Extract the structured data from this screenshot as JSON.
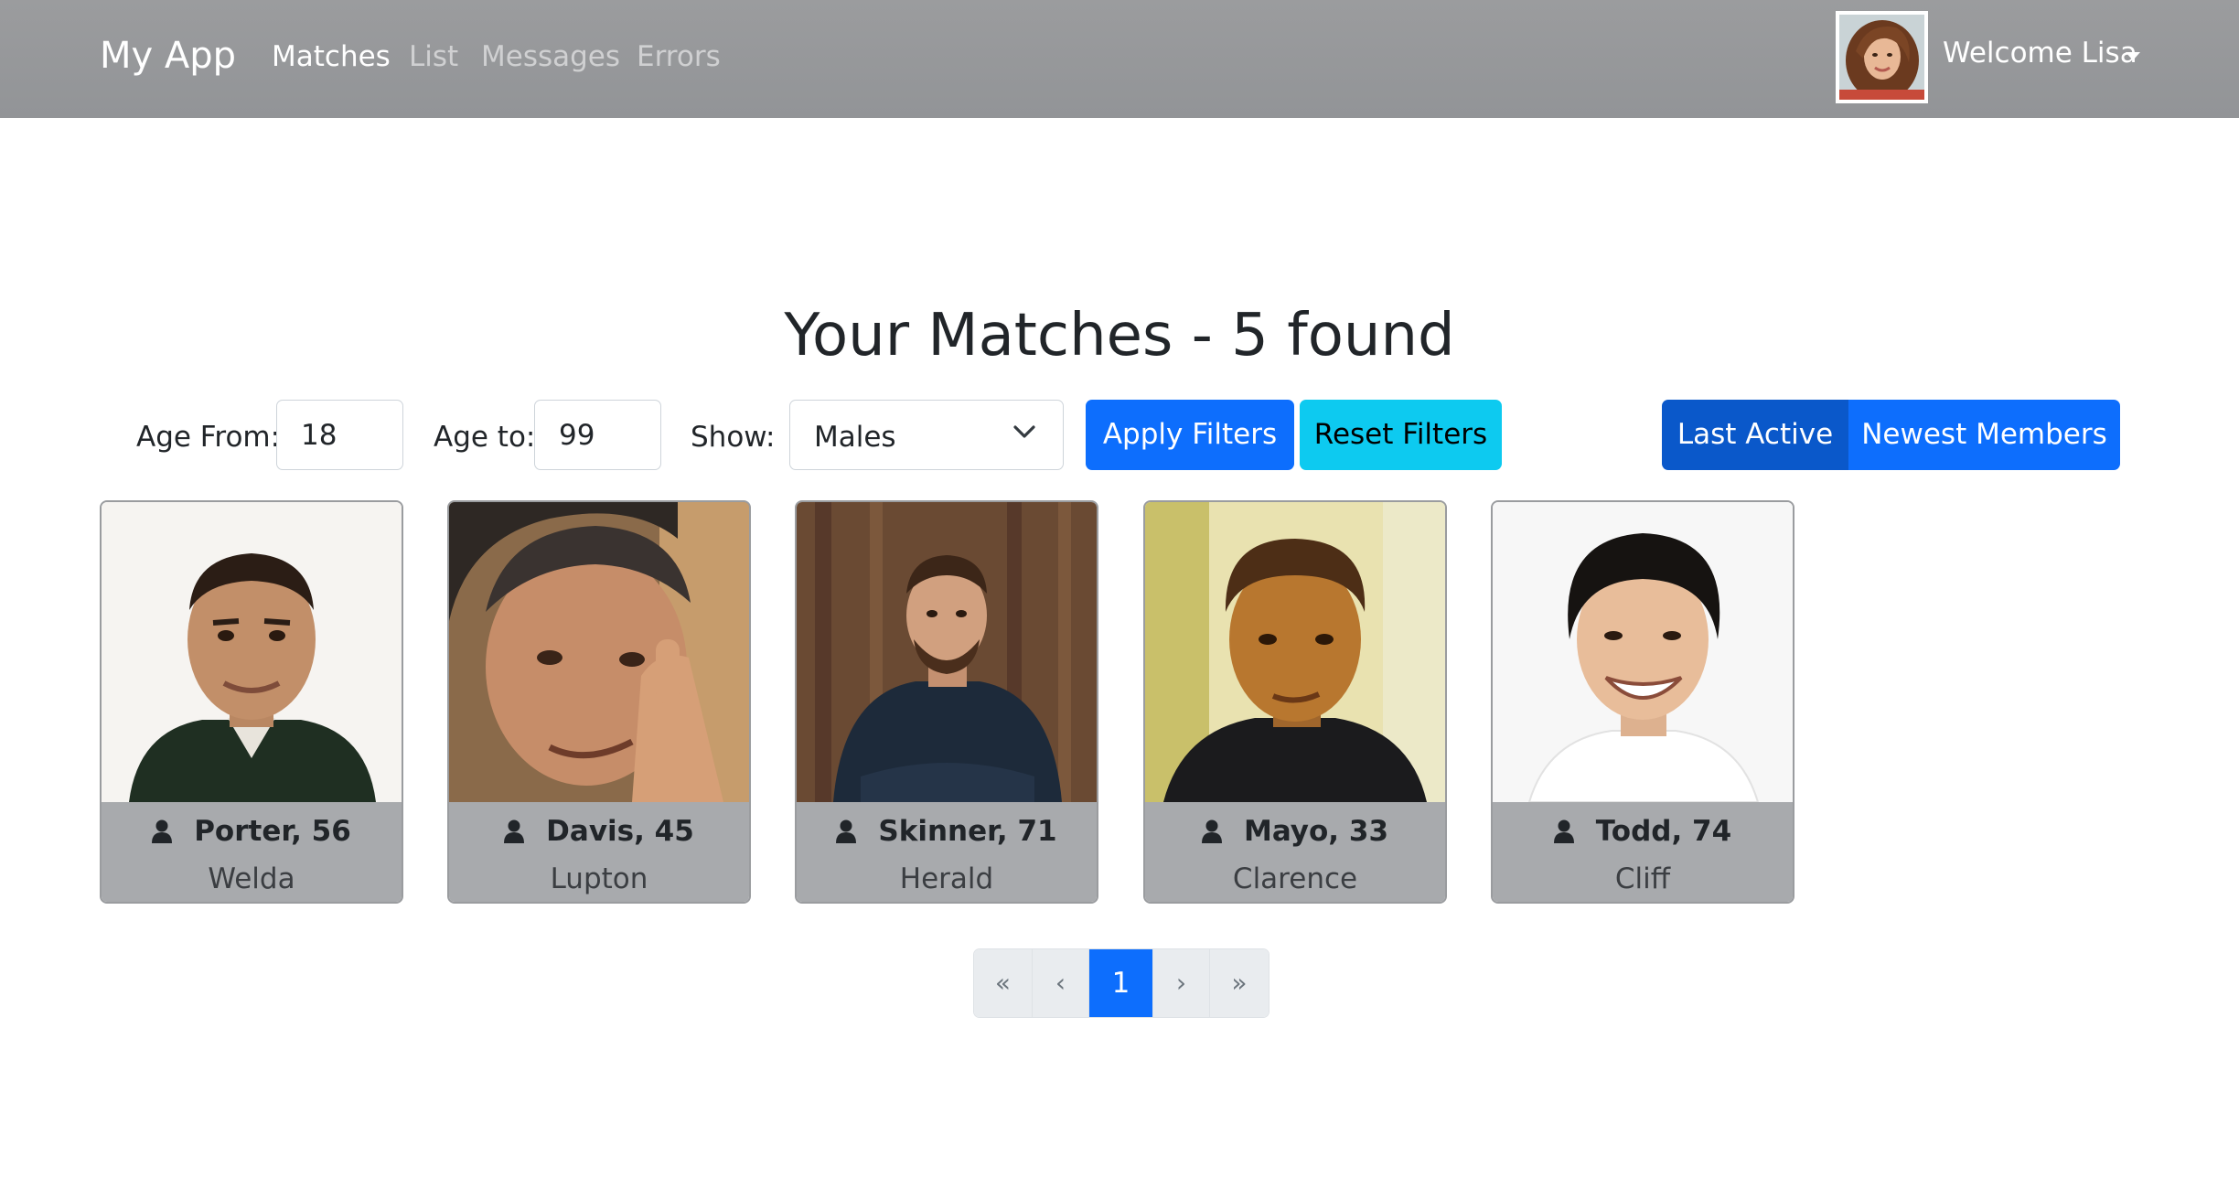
{
  "navbar": {
    "brand": "My App",
    "links": [
      {
        "label": "Matches",
        "active": true
      },
      {
        "label": "List",
        "active": false
      },
      {
        "label": "Messages",
        "active": false
      },
      {
        "label": "Errors",
        "active": false
      }
    ],
    "welcome": "Welcome Lisa",
    "avatar_icon": "user-avatar-photo"
  },
  "main": {
    "title": "Your Matches - 5 found"
  },
  "filters": {
    "age_from_label": "Age From:",
    "age_from_value": "18",
    "age_to_label": "Age to:",
    "age_to_value": "99",
    "show_label": "Show:",
    "show_value": "Males",
    "apply_label": "Apply Filters",
    "reset_label": "Reset Filters",
    "sort": {
      "last_active_label": "Last Active",
      "newest_label": "Newest Members",
      "selected": "Last Active"
    }
  },
  "members": [
    {
      "name_age": "Porter, 56",
      "city": "Welda"
    },
    {
      "name_age": "Davis, 45",
      "city": "Lupton"
    },
    {
      "name_age": "Skinner, 71",
      "city": "Herald"
    },
    {
      "name_age": "Mayo, 33",
      "city": "Clarence"
    },
    {
      "name_age": "Todd, 74",
      "city": "Cliff"
    }
  ],
  "pagination": {
    "first": "«",
    "prev": "‹",
    "current": "1",
    "next": "›",
    "last": "»"
  },
  "colors": {
    "navbar": "#97989b",
    "primary": "#0d6efd",
    "primary_active": "#0a58ca",
    "info": "#0dcaf0",
    "card_footer": "#a8aaad"
  }
}
